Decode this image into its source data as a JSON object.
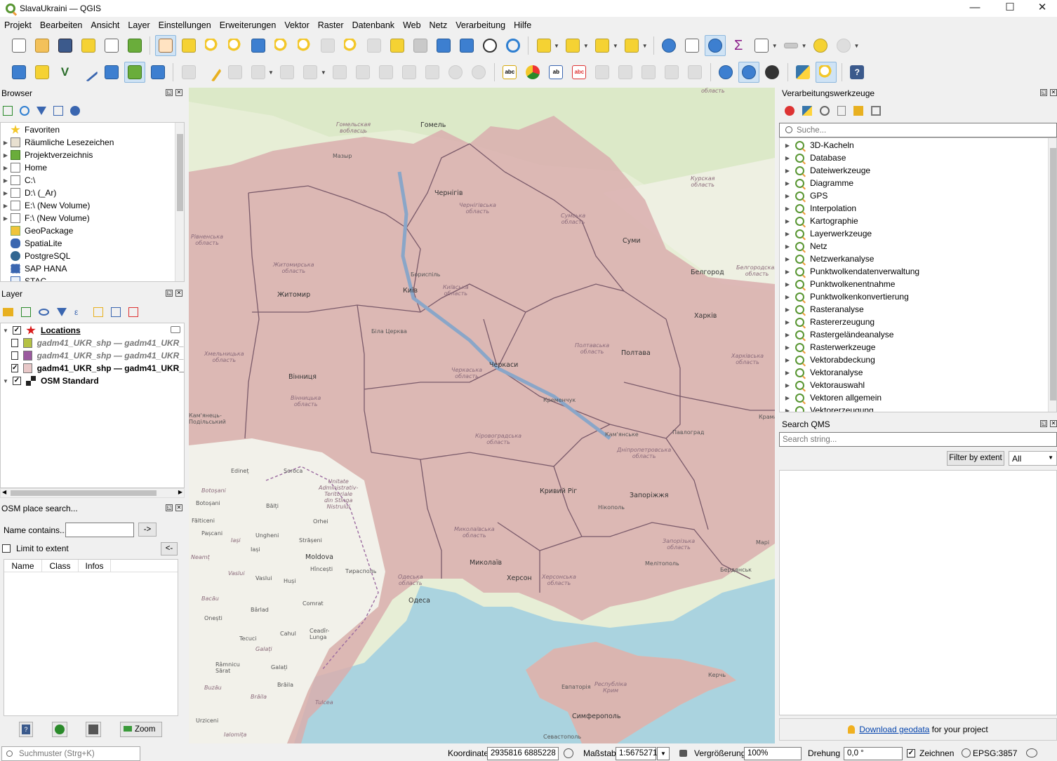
{
  "window": {
    "title": "SlavaUkraini — QGIS",
    "minimize": "—",
    "maximize": "☐",
    "close": "✕"
  },
  "menu": [
    "Projekt",
    "Bearbeiten",
    "Ansicht",
    "Layer",
    "Einstellungen",
    "Erweiterungen",
    "Vektor",
    "Raster",
    "Datenbank",
    "Web",
    "Netz",
    "Verarbeitung",
    "Hilfe"
  ],
  "browser": {
    "title": "Browser",
    "items": [
      {
        "label": "Favoriten",
        "icon": "star-icon",
        "expandable": false
      },
      {
        "label": "Räumliche Lesezeichen",
        "icon": "bookmark-icon",
        "expandable": true
      },
      {
        "label": "Projektverzeichnis",
        "icon": "project-folder-icon",
        "expandable": true
      },
      {
        "label": "Home",
        "icon": "folder-icon",
        "expandable": true
      },
      {
        "label": "C:\\",
        "icon": "drive-icon",
        "expandable": true
      },
      {
        "label": "D:\\ (_Ar)",
        "icon": "drive-icon",
        "expandable": true
      },
      {
        "label": "E:\\ (New Volume)",
        "icon": "drive-icon",
        "expandable": true
      },
      {
        "label": "F:\\ (New Volume)",
        "icon": "drive-icon",
        "expandable": true
      },
      {
        "label": "GeoPackage",
        "icon": "geopackage-icon",
        "expandable": false
      },
      {
        "label": "SpatiaLite",
        "icon": "spatialite-icon",
        "expandable": false
      },
      {
        "label": "PostgreSQL",
        "icon": "postgresql-icon",
        "expandable": false
      },
      {
        "label": "SAP HANA",
        "icon": "sap-hana-icon",
        "expandable": false
      },
      {
        "label": "STAC",
        "icon": "stac-icon",
        "expandable": false
      }
    ]
  },
  "layers": {
    "title": "Layer",
    "items": [
      {
        "label": "Locations",
        "checked": true,
        "swatch": "red-star",
        "style": "bold-underline"
      },
      {
        "label": "gadm41_UKR_shp — gadm41_UKR_",
        "checked": false,
        "swatch": "#b5c244",
        "style": "italic-grey"
      },
      {
        "label": "gadm41_UKR_shp — gadm41_UKR_",
        "checked": false,
        "swatch": "#9b5a9f",
        "style": "italic-grey"
      },
      {
        "label": "gadm41_UKR_shp — gadm41_UKR_",
        "checked": true,
        "swatch": "#e8c8c8",
        "style": "bold"
      },
      {
        "label": "OSM Standard",
        "checked": true,
        "swatch": "raster",
        "style": "bold"
      }
    ]
  },
  "osm_search": {
    "title": "OSM place search...",
    "name_label": "Name contains...",
    "go_button": "->",
    "limit_label": "Limit to extent",
    "back_button": "<-",
    "columns": [
      "Name",
      "Class",
      "Infos"
    ],
    "zoom_button": "Zoom"
  },
  "processing": {
    "title": "Verarbeitungswerkzeuge",
    "search_placeholder": "Suche...",
    "items": [
      "3D-Kacheln",
      "Database",
      "Dateiwerkzeuge",
      "Diagramme",
      "GPS",
      "Interpolation",
      "Kartographie",
      "Layerwerkzeuge",
      "Netz",
      "Netzwerkanalyse",
      "Punktwolkendatenverwaltung",
      "Punktwolkenentnahme",
      "Punktwolkenkonvertierung",
      "Rasteranalyse",
      "Rastererzeugung",
      "Rastergeländeanalyse",
      "Rasterwerkzeuge",
      "Vektorabdeckung",
      "Vektoranalyse",
      "Vektorauswahl",
      "Vektoren allgemein",
      "Vektorerzeugung"
    ]
  },
  "qms": {
    "title": "Search QMS",
    "search_placeholder": "Search string...",
    "filter_button": "Filter by extent",
    "filter_select": "All",
    "download_link": "Download geodata",
    "download_suffix": " for your project"
  },
  "map": {
    "labels": {
      "gomel": "Гомель",
      "gomel_obl": "Гомельская\nвобласць",
      "mazyr": "Мазыр",
      "chernihiv": "Чернігів",
      "chernihiv_obl": "Чернігівська\nобласть",
      "sumska": "Сумська\nобласть",
      "kurska": "Курская\nобласть",
      "sumy": "Суми",
      "belgorod": "Белгород",
      "belgorod_obl": "Белгородская\nобласть",
      "rivnenska": "Рівненська\nобласть",
      "zhytomyrska": "Житомирська\nобласть",
      "zhytomyr": "Житомир",
      "boryspil": "Бориспіль",
      "kyiv": "Київ",
      "kyivska": "Київська\nобласть",
      "kharkiv": "Харків",
      "kharkivska": "Харківська\nобласть",
      "bila": "Біла Церква",
      "poltavska": "Полтавська\nобласть",
      "poltava": "Полтава",
      "khmelnytska": "Хмельницька\nобласть",
      "vinnytsia": "Вінниця",
      "vinnytska": "Вінницька\nобласть",
      "cherkaska": "Черкаська\nобласть",
      "cherkasy": "Черкаси",
      "kremenchuk": "Кременчук",
      "kamianets": "Кам'янець-\nПодільський",
      "kirovohradska": "Кіровоградська\nобласть",
      "kamianske": "Кам'янське",
      "pavlohrad": "Павлоград",
      "dnipro": "Дніпропетровська\nобласть",
      "edinet": "Edineț",
      "soroca": "Soroca",
      "unitate": "Unitate\nAdministrativ-\nTeritoriale\ndin Stînga\nNistrului",
      "botosani_j": "Botoșani",
      "botosani": "Botoșani",
      "balti": "Bălți",
      "kryvyi": "Кривий Ріг",
      "nikopol": "Нікополь",
      "zaporizhzhia": "Запоріжжя",
      "falticeni": "Fălticeni",
      "orhei": "Orhei",
      "pascani": "Pașcani",
      "ungheni": "Ungheni",
      "iasi_j": "Iași",
      "iasi": "Iași",
      "straseni": "Strășeni",
      "mykolaivska": "Миколаївська\nобласть",
      "zaporizka": "Запорізька\nобласть",
      "mari": "Марі",
      "neamt": "Neamț",
      "moldova": "Moldova",
      "hincesti": "Hîncești",
      "tiraspol": "Тирасполь",
      "mykolaiv": "Миколаїв",
      "melitopol": "Мелітополь",
      "berdiansk": "Бердянськ",
      "vaslui_j": "Vaslui",
      "vaslui": "Vaslui",
      "husi": "Huși",
      "odeska": "Одеська\nобласть",
      "kherson": "Херсон",
      "khersonska": "Херсонська\nобласть",
      "odesa": "Одеса",
      "bacau_j": "Bacău",
      "comrat": "Comrat",
      "barlad": "Bârlad",
      "onesti": "Onești",
      "cahul": "Cahul",
      "cealac": "Ceadîr-\nLunga",
      "tecuci": "Tecuci",
      "galati_j": "Galați",
      "ramnicu": "Râmnicu\nSărat",
      "galati": "Galați",
      "braila": "Brăila",
      "buzau": "Buzău",
      "braila_j": "Brăila",
      "tulcea": "Tulcea",
      "yevpatoria": "Евпаторія",
      "krym": "Республіка\nКрим",
      "kerch": "Керчь",
      "urziceni": "Urziceni",
      "simferopol": "Симферополь",
      "ialomita": "Ialomița",
      "sevastopol": "Севастополь",
      "oblast_top": "область",
      "kramatorsk": "Крама"
    }
  },
  "status": {
    "search_placeholder": "Suchmuster (Strg+K)",
    "coord_label": "Koordinate",
    "coord_value": "2935816  6885228",
    "scale_label": "Maßstab",
    "scale_value": "1:5675271",
    "magnifier_label": "Vergrößerung",
    "magnifier_value": "100%",
    "rotation_label": "Drehung",
    "rotation_value": "0,0 °",
    "render_label": "Zeichnen",
    "render_checked": true,
    "crs": "EPSG:3857"
  }
}
